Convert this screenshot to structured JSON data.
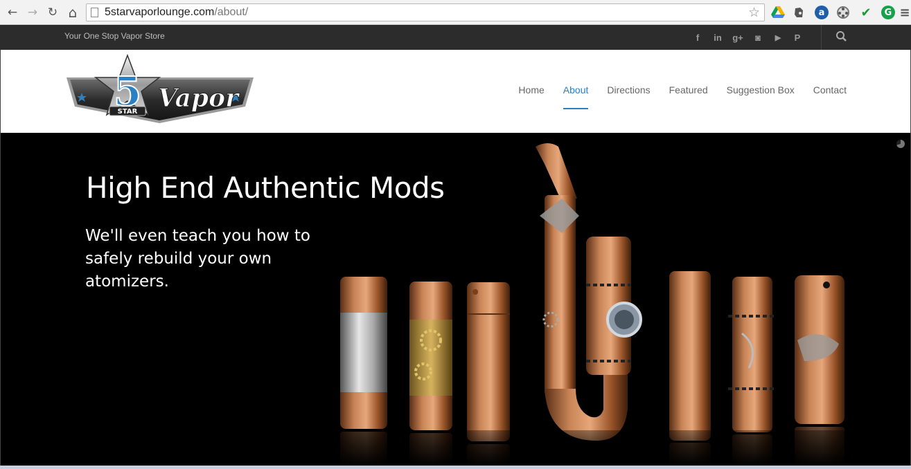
{
  "browser": {
    "url_domain": "5starvaporlounge.com",
    "url_path": "/about/",
    "back_glyph": "←",
    "forward_glyph": "→",
    "reload_glyph": "↻",
    "home_glyph": "⌂",
    "star_glyph": "☆",
    "extensions": [
      {
        "name": "drive-icon"
      },
      {
        "name": "evernote-icon"
      },
      {
        "name": "amazon-icon",
        "glyph": "a"
      },
      {
        "name": "film-reel-icon"
      },
      {
        "name": "checkmark-icon",
        "glyph": "✔"
      },
      {
        "name": "grammarly-icon",
        "glyph": "G"
      },
      {
        "name": "menu-icon",
        "glyph": "≡"
      }
    ]
  },
  "topbar": {
    "tagline": "Your One Stop Vapor Store",
    "social": [
      {
        "name": "facebook-icon",
        "glyph": "f"
      },
      {
        "name": "linkedin-icon",
        "glyph": "in"
      },
      {
        "name": "googleplus-icon",
        "glyph": "g+"
      },
      {
        "name": "instagram-icon",
        "glyph": "◙"
      },
      {
        "name": "youtube-icon",
        "glyph": "▶"
      },
      {
        "name": "pinterest-icon",
        "glyph": "P"
      }
    ]
  },
  "logo": {
    "number": "5",
    "star_text": "STAR",
    "brand": "Vapor"
  },
  "nav": {
    "items": [
      {
        "label": "Home",
        "active": false
      },
      {
        "label": "About",
        "active": true
      },
      {
        "label": "Directions",
        "active": false
      },
      {
        "label": "Featured",
        "active": false
      },
      {
        "label": "Suggestion Box",
        "active": false
      },
      {
        "label": "Contact",
        "active": false
      }
    ]
  },
  "hero": {
    "title": "High End Authentic Mods",
    "subtitle": "We'll even teach you how to safely rebuild your own atomizers."
  },
  "colors": {
    "accent": "#2a80c4",
    "topbar": "#2c2c2c",
    "copper": "#b5713f"
  }
}
